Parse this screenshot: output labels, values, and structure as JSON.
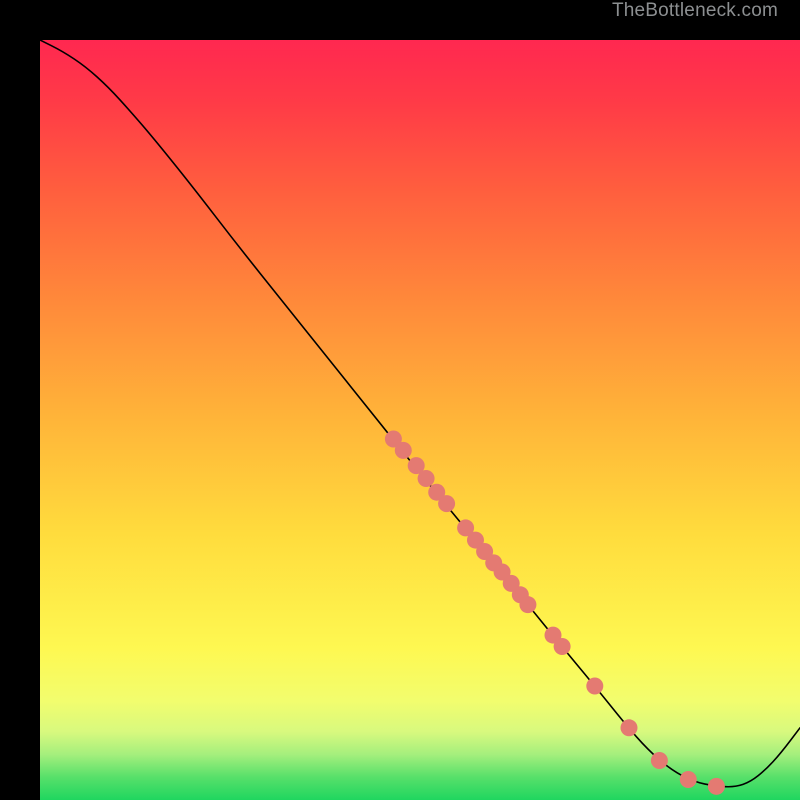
{
  "watermark": "TheBottleneck.com",
  "chart_data": {
    "type": "line",
    "title": "",
    "xlabel": "",
    "ylabel": "",
    "xlim": [
      0,
      100
    ],
    "ylim": [
      0,
      100
    ],
    "gradient_bands": [
      {
        "offset": 0.0,
        "color": "#1fd65f"
      },
      {
        "offset": 0.03,
        "color": "#57e06a"
      },
      {
        "offset": 0.06,
        "color": "#a5ef7d"
      },
      {
        "offset": 0.09,
        "color": "#d8f97e"
      },
      {
        "offset": 0.13,
        "color": "#f2fd6e"
      },
      {
        "offset": 0.2,
        "color": "#fef851"
      },
      {
        "offset": 0.35,
        "color": "#ffdc3d"
      },
      {
        "offset": 0.5,
        "color": "#ffb539"
      },
      {
        "offset": 0.65,
        "color": "#ff8b3a"
      },
      {
        "offset": 0.8,
        "color": "#ff5f3e"
      },
      {
        "offset": 0.92,
        "color": "#ff3a47"
      },
      {
        "offset": 1.0,
        "color": "#ff2850"
      }
    ],
    "series": [
      {
        "name": "bottleneck-curve",
        "stroke": "#000000",
        "stroke_width": 1.6,
        "points": [
          {
            "x": 0.0,
            "y": 100.0
          },
          {
            "x": 3.0,
            "y": 98.5
          },
          {
            "x": 6.0,
            "y": 96.5
          },
          {
            "x": 9.0,
            "y": 93.8
          },
          {
            "x": 12.0,
            "y": 90.5
          },
          {
            "x": 15.0,
            "y": 87.0
          },
          {
            "x": 20.0,
            "y": 80.8
          },
          {
            "x": 26.0,
            "y": 73.0
          },
          {
            "x": 32.0,
            "y": 65.5
          },
          {
            "x": 38.0,
            "y": 58.0
          },
          {
            "x": 44.0,
            "y": 50.5
          },
          {
            "x": 50.0,
            "y": 43.0
          },
          {
            "x": 56.0,
            "y": 35.7
          },
          {
            "x": 62.0,
            "y": 28.4
          },
          {
            "x": 68.0,
            "y": 21.0
          },
          {
            "x": 73.0,
            "y": 15.0
          },
          {
            "x": 77.0,
            "y": 10.0
          },
          {
            "x": 80.0,
            "y": 6.6
          },
          {
            "x": 83.0,
            "y": 4.0
          },
          {
            "x": 86.0,
            "y": 2.4
          },
          {
            "x": 89.0,
            "y": 1.8
          },
          {
            "x": 91.5,
            "y": 1.7
          },
          {
            "x": 93.5,
            "y": 2.4
          },
          {
            "x": 95.5,
            "y": 4.0
          },
          {
            "x": 97.5,
            "y": 6.2
          },
          {
            "x": 100.0,
            "y": 9.5
          }
        ]
      }
    ],
    "markers": {
      "color": "#e47a72",
      "radius": 8.5,
      "points": [
        {
          "x": 46.5,
          "y": 47.5
        },
        {
          "x": 47.8,
          "y": 46.0
        },
        {
          "x": 49.5,
          "y": 44.0
        },
        {
          "x": 50.8,
          "y": 42.3
        },
        {
          "x": 52.2,
          "y": 40.5
        },
        {
          "x": 53.5,
          "y": 39.0
        },
        {
          "x": 56.0,
          "y": 35.8
        },
        {
          "x": 57.3,
          "y": 34.2
        },
        {
          "x": 58.5,
          "y": 32.7
        },
        {
          "x": 59.7,
          "y": 31.2
        },
        {
          "x": 60.8,
          "y": 30.0
        },
        {
          "x": 62.0,
          "y": 28.5
        },
        {
          "x": 63.2,
          "y": 27.0
        },
        {
          "x": 64.2,
          "y": 25.7
        },
        {
          "x": 67.5,
          "y": 21.7
        },
        {
          "x": 68.7,
          "y": 20.2
        },
        {
          "x": 73.0,
          "y": 15.0
        },
        {
          "x": 77.5,
          "y": 9.5
        },
        {
          "x": 81.5,
          "y": 5.2
        },
        {
          "x": 85.3,
          "y": 2.7
        },
        {
          "x": 89.0,
          "y": 1.8
        }
      ]
    }
  }
}
